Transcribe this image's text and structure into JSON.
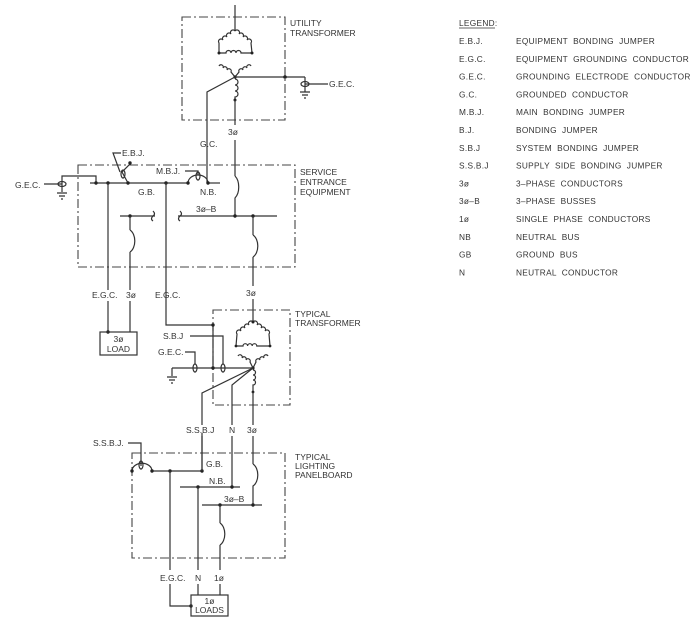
{
  "labels": {
    "utility_transformer": [
      "UTILITY",
      "TRANSFORMER"
    ],
    "gec_utility": "G.E.C.",
    "gc": "G.C.",
    "three_phase_utility": "3ø",
    "ebj": "E.B.J.",
    "mbj": "M.B.J.",
    "gec_service": "G.E.C.",
    "gb_service": "G.B.",
    "nb_service": "N.B.",
    "bus_service": "3ø–B",
    "service_equipment": [
      "SERVICE",
      "ENTRANCE",
      "EQUIPMENT"
    ],
    "egc_load": "E.G.C.",
    "three_phase_load": "3ø",
    "egc_transformer": "E.G.C.",
    "three_phase_transformer_in": "3ø",
    "load_box": [
      "3ø",
      "LOAD"
    ],
    "typical_transformer": [
      "TYPICAL",
      "TRANSFORMER"
    ],
    "sbj": "S.B.J",
    "gec_transformer": "G.E.C.",
    "ssbj_wire": "S.S.B.J",
    "n_wire": "N",
    "three_phase_panel_in": "3ø",
    "ssbj_panel": "S.S.B.J.",
    "gb_panel": "G.B.",
    "nb_panel": "N.B.",
    "bus_panel": "3ø–B",
    "lighting_panelboard": [
      "TYPICAL",
      "LIGHTING",
      "PANELBOARD"
    ],
    "egc_loads": "E.G.C.",
    "n_loads": "N",
    "one_phase_loads": "1ø",
    "loads_box": [
      "1ø",
      "LOADS"
    ]
  },
  "legend": {
    "title": "LEGEND:",
    "items": [
      {
        "abbr": "E.B.J.",
        "desc": "EQUIPMENT  BONDING  JUMPER"
      },
      {
        "abbr": "E.G.C.",
        "desc": "EQUIPMENT  GROUNDING  CONDUCTOR"
      },
      {
        "abbr": "G.E.C.",
        "desc": "GROUNDING  ELECTRODE  CONDUCTOR"
      },
      {
        "abbr": "G.C.",
        "desc": "GROUNDED  CONDUCTOR"
      },
      {
        "abbr": "M.B.J.",
        "desc": "MAIN  BONDING  JUMPER"
      },
      {
        "abbr": "B.J.",
        "desc": "BONDING  JUMPER"
      },
      {
        "abbr": "S.B.J",
        "desc": "SYSTEM  BONDING  JUMPER"
      },
      {
        "abbr": "S.S.B.J",
        "desc": "SUPPLY  SIDE  BONDING  JUMPER"
      },
      {
        "abbr": "3ø",
        "desc": "3–PHASE  CONDUCTORS"
      },
      {
        "abbr": "3ø–B",
        "desc": "3–PHASE  BUSSES"
      },
      {
        "abbr": "1ø",
        "desc": "SINGLE  PHASE  CONDUCTORS"
      },
      {
        "abbr": "NB",
        "desc": "NEUTRAL  BUS"
      },
      {
        "abbr": "GB",
        "desc": "GROUND  BUS"
      },
      {
        "abbr": "N",
        "desc": "NEUTRAL  CONDUCTOR"
      }
    ]
  }
}
